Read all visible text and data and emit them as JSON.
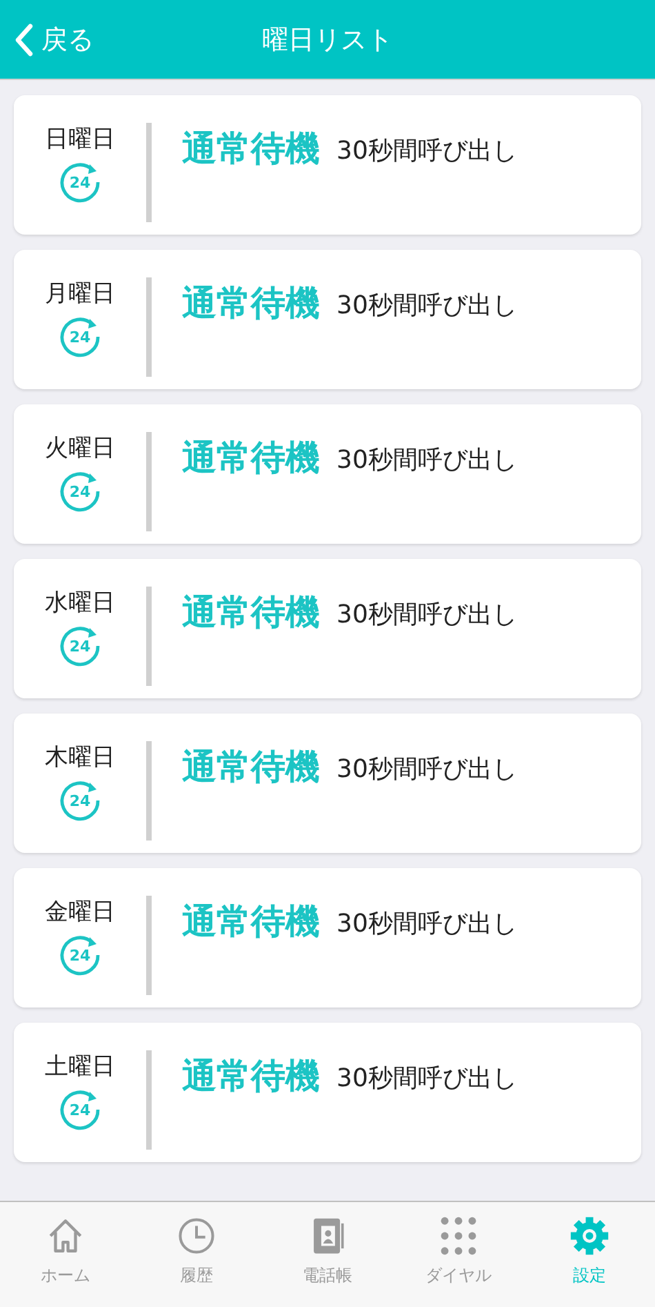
{
  "header": {
    "back": "戻る",
    "title": "曜日リスト"
  },
  "days": [
    {
      "day": "日曜日",
      "badge": "24",
      "mode": "通常待機",
      "detail": "30秒間呼び出し"
    },
    {
      "day": "月曜日",
      "badge": "24",
      "mode": "通常待機",
      "detail": "30秒間呼び出し"
    },
    {
      "day": "火曜日",
      "badge": "24",
      "mode": "通常待機",
      "detail": "30秒間呼び出し"
    },
    {
      "day": "水曜日",
      "badge": "24",
      "mode": "通常待機",
      "detail": "30秒間呼び出し"
    },
    {
      "day": "木曜日",
      "badge": "24",
      "mode": "通常待機",
      "detail": "30秒間呼び出し"
    },
    {
      "day": "金曜日",
      "badge": "24",
      "mode": "通常待機",
      "detail": "30秒間呼び出し"
    },
    {
      "day": "土曜日",
      "badge": "24",
      "mode": "通常待機",
      "detail": "30秒間呼び出し"
    }
  ],
  "tabs": [
    {
      "kind": "home",
      "label": "ホーム",
      "selected": false
    },
    {
      "kind": "history",
      "label": "履歴",
      "selected": false
    },
    {
      "kind": "contacts",
      "label": "電話帳",
      "selected": false
    },
    {
      "kind": "dial",
      "label": "ダイヤル",
      "selected": false
    },
    {
      "kind": "settings",
      "label": "設定",
      "selected": true
    }
  ]
}
